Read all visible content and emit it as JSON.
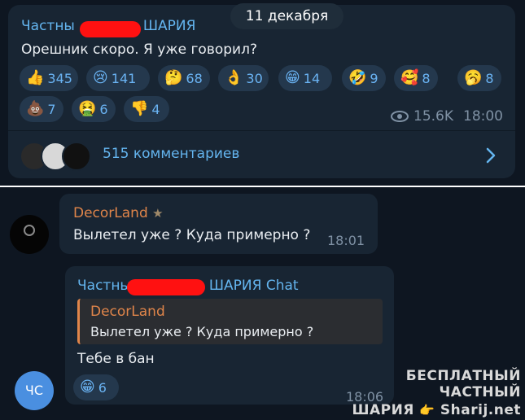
{
  "date_separator": "11 декабря",
  "post": {
    "channel_name_start": "Частны",
    "channel_name_end": "ШАРИЯ",
    "text": "Орешник скоро. Я уже говорил?",
    "reactions": [
      {
        "icon": "thumbs-up-icon",
        "emoji": "👍",
        "count": "345"
      },
      {
        "icon": "crying-face-icon",
        "emoji": "😢",
        "count": "141"
      },
      {
        "icon": "thinking-face-icon",
        "emoji": "🤔",
        "count": "68"
      },
      {
        "icon": "ok-hand-icon",
        "emoji": "👌",
        "count": "30"
      },
      {
        "icon": "grinning-face-icon",
        "emoji": "😁",
        "count": "14"
      },
      {
        "icon": "rolling-laughing-icon",
        "emoji": "🤣",
        "count": "9"
      },
      {
        "icon": "hearts-face-icon",
        "emoji": "🥰",
        "count": "8"
      },
      {
        "icon": "yawning-face-icon",
        "emoji": "🥱",
        "count": "8"
      },
      {
        "icon": "poop-icon",
        "emoji": "💩",
        "count": "7"
      },
      {
        "icon": "nauseated-face-icon",
        "emoji": "🤮",
        "count": "6"
      },
      {
        "icon": "thumbs-down-icon",
        "emoji": "👎",
        "count": "4"
      }
    ],
    "views": "15.6K",
    "time": "18:00",
    "comments_label": "515 комментариев"
  },
  "comment1": {
    "author": "DecorLand",
    "text": "Вылетел уже ? Куда примерно ?",
    "time": "18:01"
  },
  "comment2": {
    "author_start": "Частны",
    "author_end": "ШАРИЯ Chat",
    "quote_author": "DecorLand",
    "quote_text": "Вылетел уже ? Куда примерно ?",
    "text": "Тебе в бан",
    "reaction": {
      "icon": "grinning-face-icon",
      "emoji": "😁",
      "count": "6"
    },
    "time": "18:06",
    "avatar_initials": "ЧС"
  },
  "watermark": {
    "line1": "БЕСПЛАТНЫЙ ЧАСТНЫЙ",
    "line2_start": "ШАРИЯ",
    "line2_end": "Sharij.net"
  },
  "colors": {
    "accent": "#64b5ef",
    "background": "#0e1621",
    "bubble": "#182533",
    "quote_accent": "#e0854a",
    "redaction": "#ff1111"
  }
}
